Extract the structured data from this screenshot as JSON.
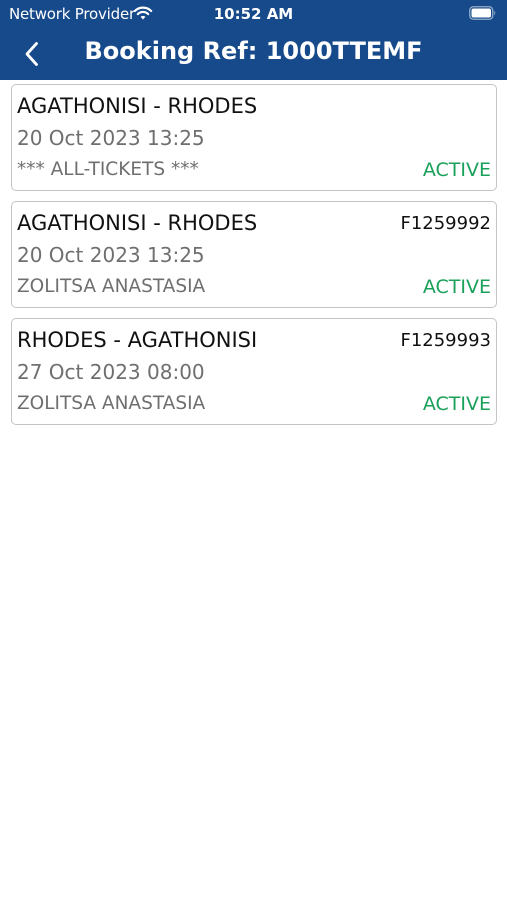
{
  "status_bar": {
    "carrier": "Network Provider",
    "time": "10:52 AM",
    "icons": [
      "wifi-icon",
      "battery-icon"
    ]
  },
  "nav": {
    "back_icon": "chevron-left-icon",
    "title": "Booking Ref: 1000TTEMF"
  },
  "colors": {
    "header_background": "#174a8a",
    "header_text": "#ffffff",
    "status_active": "#1aa05a",
    "secondary_text": "#6f6f6f",
    "card_border": "#c4c4c4"
  },
  "bookings": [
    {
      "route": "AGATHONISI - RHODES",
      "ticket": "",
      "datetime": "20 Oct 2023 13:25",
      "passenger": "*** ALL-TICKETS ***",
      "status": "ACTIVE"
    },
    {
      "route": "AGATHONISI - RHODES",
      "ticket": "F1259992",
      "datetime": "20 Oct 2023 13:25",
      "passenger": "ZOLITSA ANASTASIA",
      "status": "ACTIVE"
    },
    {
      "route": "RHODES - AGATHONISI",
      "ticket": "F1259993",
      "datetime": "27 Oct 2023 08:00",
      "passenger": "ZOLITSA ANASTASIA",
      "status": "ACTIVE"
    }
  ]
}
